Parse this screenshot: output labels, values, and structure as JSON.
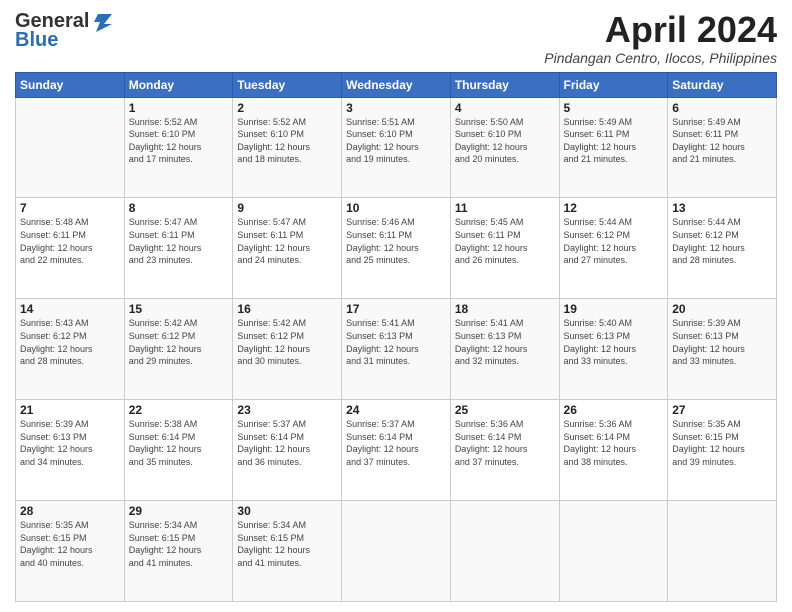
{
  "header": {
    "logo_general": "General",
    "logo_blue": "Blue",
    "title": "April 2024",
    "location": "Pindangan Centro, Ilocos, Philippines"
  },
  "calendar": {
    "days_of_week": [
      "Sunday",
      "Monday",
      "Tuesday",
      "Wednesday",
      "Thursday",
      "Friday",
      "Saturday"
    ],
    "weeks": [
      [
        {
          "day": "",
          "info": ""
        },
        {
          "day": "1",
          "info": "Sunrise: 5:52 AM\nSunset: 6:10 PM\nDaylight: 12 hours\nand 17 minutes."
        },
        {
          "day": "2",
          "info": "Sunrise: 5:52 AM\nSunset: 6:10 PM\nDaylight: 12 hours\nand 18 minutes."
        },
        {
          "day": "3",
          "info": "Sunrise: 5:51 AM\nSunset: 6:10 PM\nDaylight: 12 hours\nand 19 minutes."
        },
        {
          "day": "4",
          "info": "Sunrise: 5:50 AM\nSunset: 6:10 PM\nDaylight: 12 hours\nand 20 minutes."
        },
        {
          "day": "5",
          "info": "Sunrise: 5:49 AM\nSunset: 6:11 PM\nDaylight: 12 hours\nand 21 minutes."
        },
        {
          "day": "6",
          "info": "Sunrise: 5:49 AM\nSunset: 6:11 PM\nDaylight: 12 hours\nand 21 minutes."
        }
      ],
      [
        {
          "day": "7",
          "info": "Sunrise: 5:48 AM\nSunset: 6:11 PM\nDaylight: 12 hours\nand 22 minutes."
        },
        {
          "day": "8",
          "info": "Sunrise: 5:47 AM\nSunset: 6:11 PM\nDaylight: 12 hours\nand 23 minutes."
        },
        {
          "day": "9",
          "info": "Sunrise: 5:47 AM\nSunset: 6:11 PM\nDaylight: 12 hours\nand 24 minutes."
        },
        {
          "day": "10",
          "info": "Sunrise: 5:46 AM\nSunset: 6:11 PM\nDaylight: 12 hours\nand 25 minutes."
        },
        {
          "day": "11",
          "info": "Sunrise: 5:45 AM\nSunset: 6:11 PM\nDaylight: 12 hours\nand 26 minutes."
        },
        {
          "day": "12",
          "info": "Sunrise: 5:44 AM\nSunset: 6:12 PM\nDaylight: 12 hours\nand 27 minutes."
        },
        {
          "day": "13",
          "info": "Sunrise: 5:44 AM\nSunset: 6:12 PM\nDaylight: 12 hours\nand 28 minutes."
        }
      ],
      [
        {
          "day": "14",
          "info": "Sunrise: 5:43 AM\nSunset: 6:12 PM\nDaylight: 12 hours\nand 28 minutes."
        },
        {
          "day": "15",
          "info": "Sunrise: 5:42 AM\nSunset: 6:12 PM\nDaylight: 12 hours\nand 29 minutes."
        },
        {
          "day": "16",
          "info": "Sunrise: 5:42 AM\nSunset: 6:12 PM\nDaylight: 12 hours\nand 30 minutes."
        },
        {
          "day": "17",
          "info": "Sunrise: 5:41 AM\nSunset: 6:13 PM\nDaylight: 12 hours\nand 31 minutes."
        },
        {
          "day": "18",
          "info": "Sunrise: 5:41 AM\nSunset: 6:13 PM\nDaylight: 12 hours\nand 32 minutes."
        },
        {
          "day": "19",
          "info": "Sunrise: 5:40 AM\nSunset: 6:13 PM\nDaylight: 12 hours\nand 33 minutes."
        },
        {
          "day": "20",
          "info": "Sunrise: 5:39 AM\nSunset: 6:13 PM\nDaylight: 12 hours\nand 33 minutes."
        }
      ],
      [
        {
          "day": "21",
          "info": "Sunrise: 5:39 AM\nSunset: 6:13 PM\nDaylight: 12 hours\nand 34 minutes."
        },
        {
          "day": "22",
          "info": "Sunrise: 5:38 AM\nSunset: 6:14 PM\nDaylight: 12 hours\nand 35 minutes."
        },
        {
          "day": "23",
          "info": "Sunrise: 5:37 AM\nSunset: 6:14 PM\nDaylight: 12 hours\nand 36 minutes."
        },
        {
          "day": "24",
          "info": "Sunrise: 5:37 AM\nSunset: 6:14 PM\nDaylight: 12 hours\nand 37 minutes."
        },
        {
          "day": "25",
          "info": "Sunrise: 5:36 AM\nSunset: 6:14 PM\nDaylight: 12 hours\nand 37 minutes."
        },
        {
          "day": "26",
          "info": "Sunrise: 5:36 AM\nSunset: 6:14 PM\nDaylight: 12 hours\nand 38 minutes."
        },
        {
          "day": "27",
          "info": "Sunrise: 5:35 AM\nSunset: 6:15 PM\nDaylight: 12 hours\nand 39 minutes."
        }
      ],
      [
        {
          "day": "28",
          "info": "Sunrise: 5:35 AM\nSunset: 6:15 PM\nDaylight: 12 hours\nand 40 minutes."
        },
        {
          "day": "29",
          "info": "Sunrise: 5:34 AM\nSunset: 6:15 PM\nDaylight: 12 hours\nand 41 minutes."
        },
        {
          "day": "30",
          "info": "Sunrise: 5:34 AM\nSunset: 6:15 PM\nDaylight: 12 hours\nand 41 minutes."
        },
        {
          "day": "",
          "info": ""
        },
        {
          "day": "",
          "info": ""
        },
        {
          "day": "",
          "info": ""
        },
        {
          "day": "",
          "info": ""
        }
      ]
    ]
  }
}
